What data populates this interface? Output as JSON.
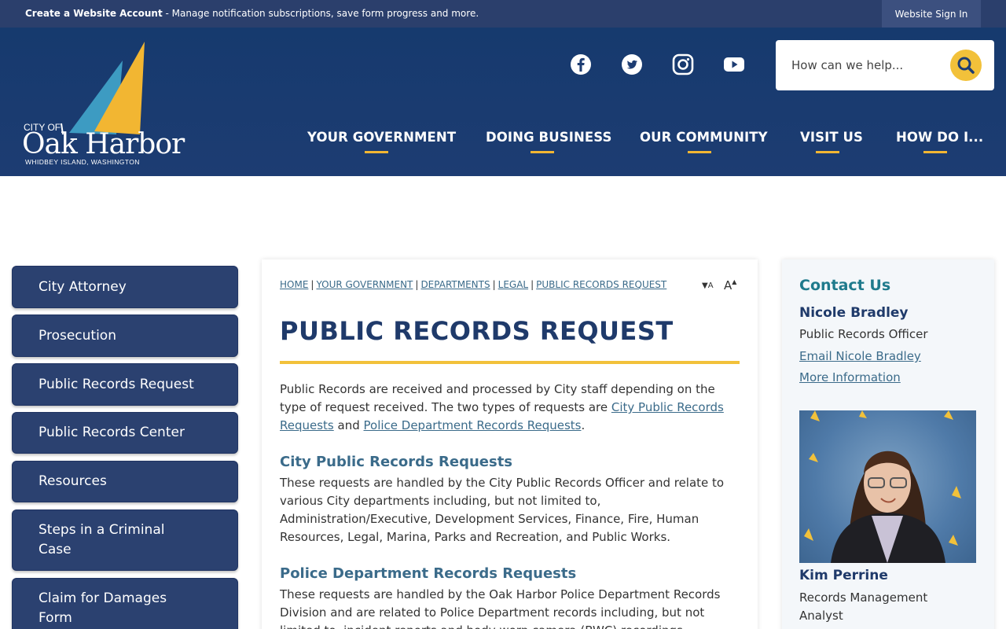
{
  "topbar": {
    "create_account": "Create a Website Account",
    "message": " - Manage notification subscriptions, save form progress and more.",
    "signin": "Website Sign In"
  },
  "logo": {
    "city_of": "CITY OF",
    "name": "Oak Harbor",
    "tagline": "WHIDBEY ISLAND, WASHINGTON"
  },
  "social": [
    "facebook-icon",
    "twitter-icon",
    "instagram-icon",
    "youtube-icon"
  ],
  "search": {
    "placeholder": "How can we help..."
  },
  "nav": [
    "YOUR GOVERNMENT",
    "DOING BUSINESS",
    "OUR COMMUNITY",
    "VISIT US",
    "HOW DO I..."
  ],
  "sidebar": [
    "City Attorney",
    "Prosecution",
    "Public Records Request",
    "Public Records Center",
    "Resources",
    "Steps in a Criminal Case",
    "Claim for Damages Form"
  ],
  "breadcrumb": [
    "HOME",
    "YOUR GOVERNMENT",
    "DEPARTMENTS",
    "LEGAL",
    "PUBLIC RECORDS REQUEST"
  ],
  "resize": {
    "decrease": "A",
    "increase": "A"
  },
  "main": {
    "title": "PUBLIC RECORDS REQUEST",
    "intro_1": "Public Records are received and processed by City staff depending on the type of request received. The two types of requests are ",
    "intro_link_1": "City Public Records Requests",
    "intro_and": " and ",
    "intro_link_2": "Police Department Records Requests",
    "intro_end": ".",
    "city_heading": "City Public Records Requests",
    "city_text": "These requests are handled by the City Public Records Officer and relate to various City departments including, but not limited to, Administration/Executive, Development Services, Finance, Fire, Human Resources, Legal, Marina, Parks and Recreation, and Public Works.",
    "police_heading": "Police Department Records Requests",
    "police_text": "These requests are handled by the Oak Harbor Police Department Records Division and are related to Police Department records including, but not limited to, incident reports and body worn camera (BWC) recordings."
  },
  "contact": {
    "heading": "Contact Us",
    "name_1": "Nicole Bradley",
    "role_1": "Public Records Officer",
    "email_1": "Email Nicole Bradley",
    "more_info": "More Information",
    "name_2": "Kim Perrine",
    "role_2": "Records Management Analyst"
  },
  "colors": {
    "topbar": "#2b3f6c",
    "header": "#1d3c72",
    "accent_gold": "#f2c13a",
    "sidebar_button": "#2b4170",
    "link": "#3b6b8a",
    "title": "#1f3a6a"
  }
}
